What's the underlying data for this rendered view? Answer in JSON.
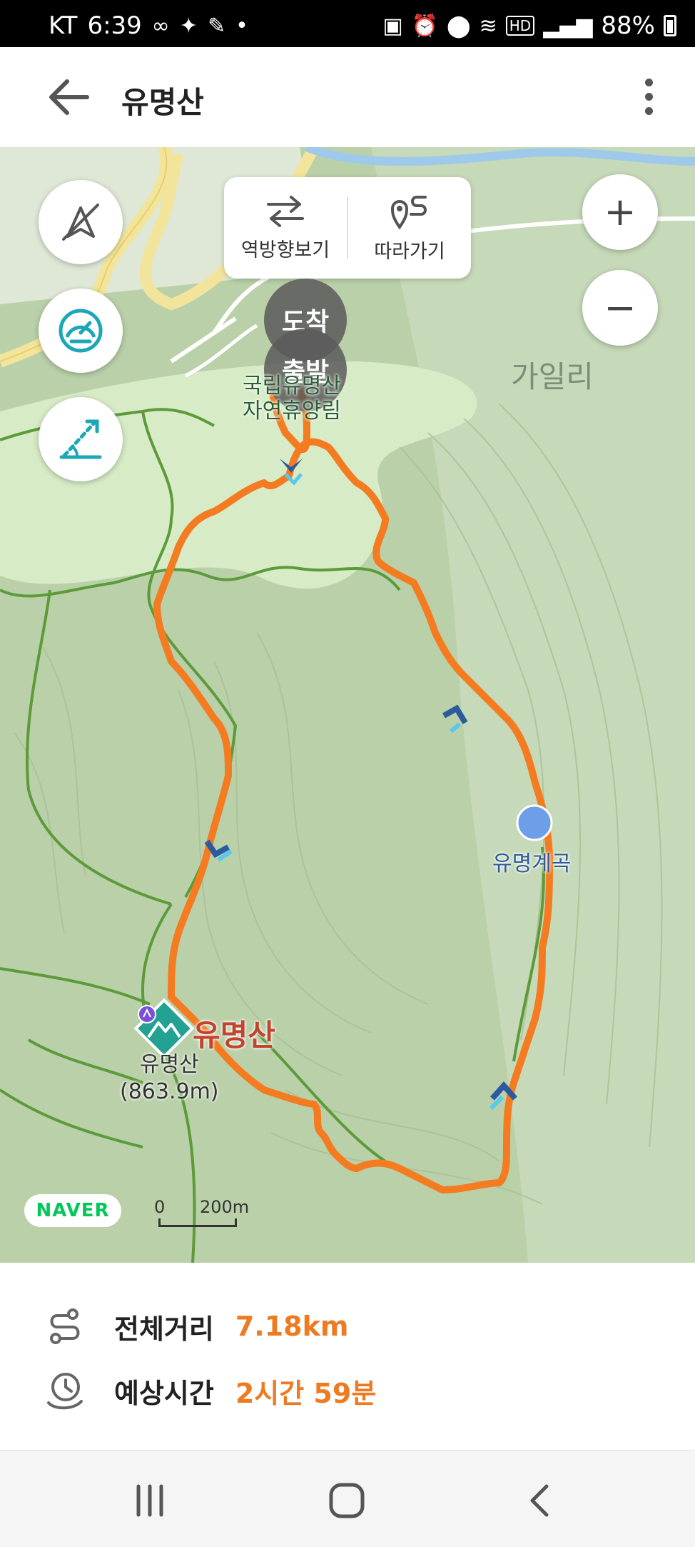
{
  "status_bar": {
    "carrier": "KT",
    "time": "6:39",
    "left_icons": [
      "infinity-icon",
      "shoe-icon",
      "feather-icon",
      "dot-icon"
    ],
    "right_icons": [
      "app-icon",
      "alarm-icon",
      "location-icon",
      "wifi-icon",
      "hd-icon",
      "signal-icon"
    ],
    "battery": "88%"
  },
  "app_bar": {
    "title": "유명산",
    "back_icon": "arrow-left-icon",
    "menu_icon": "more-vertical-icon"
  },
  "map": {
    "left_controls": [
      {
        "name": "compass-off-icon"
      },
      {
        "name": "speedometer-icon"
      },
      {
        "name": "slope-icon"
      }
    ],
    "route_tools": {
      "reverse_label": "역방향보기",
      "follow_label": "따라가기"
    },
    "zoom": {
      "in": "+",
      "out": "−"
    },
    "markers": {
      "arrive": "도착",
      "depart": "출발"
    },
    "labels": {
      "forest_line1": "국립유명산",
      "forest_line2": "자연휴양림",
      "village": "가일리",
      "peak_title": "유명산",
      "peak_name": "유명산",
      "peak_elevation": "(863.9m)",
      "valley": "유명계곡"
    },
    "brand": "NAVER",
    "scale": {
      "zero": "0",
      "distance": "200m"
    },
    "route_color": "#f47b20"
  },
  "info": {
    "distance_label": "전체거리",
    "distance_value": "7.18km",
    "time_label": "예상시간",
    "time_value": "2시간 59분"
  },
  "nav_bar": {
    "recents_icon": "recents-icon",
    "home_icon": "home-icon",
    "back_icon": "back-icon"
  }
}
